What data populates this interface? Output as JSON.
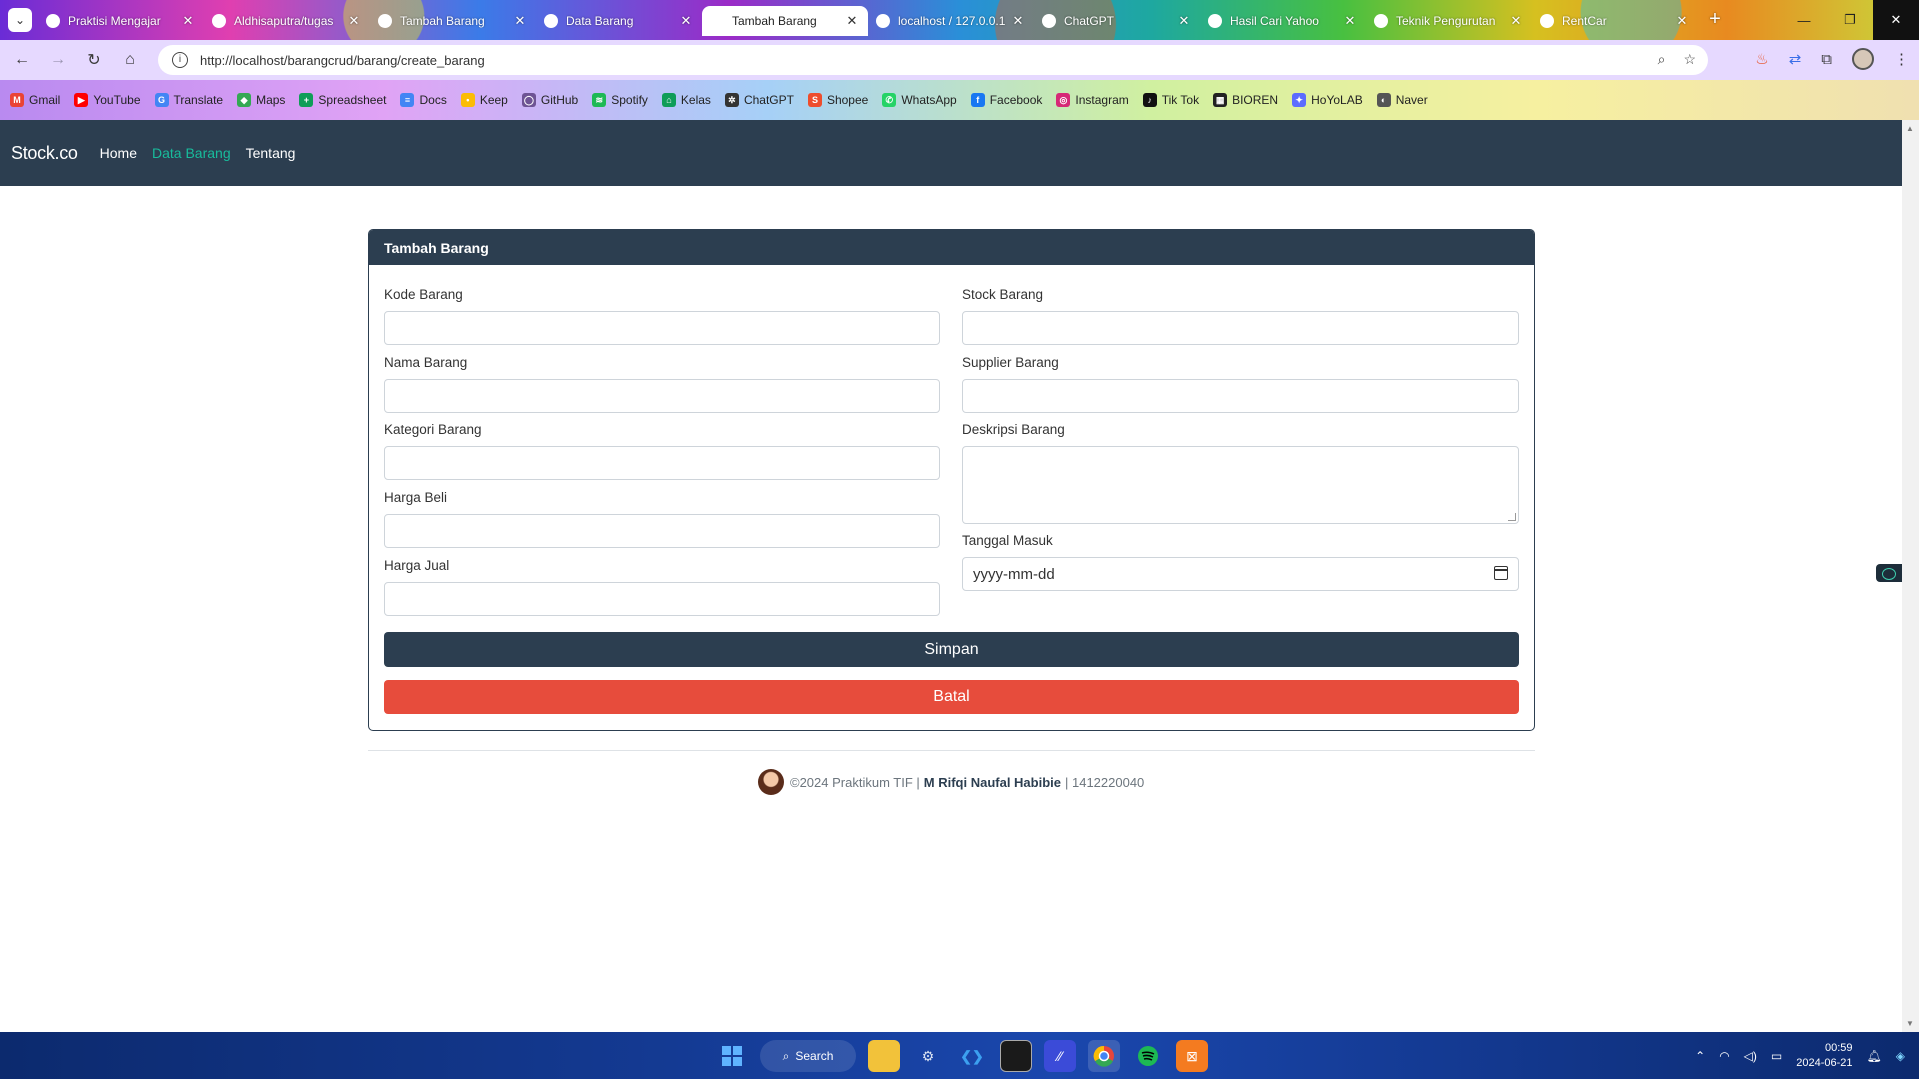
{
  "browser": {
    "tabs": [
      {
        "title": "Praktisi Mengajar",
        "icon": "person-icon",
        "color": "#4a7be8"
      },
      {
        "title": "Aldhisaputra/tugas",
        "icon": "github-icon",
        "color": "#222222"
      },
      {
        "title": "Tambah Barang",
        "icon": "person-photo-icon",
        "color": "#555555"
      },
      {
        "title": "Data Barang",
        "icon": "person-photo-icon",
        "color": "#a0522d"
      },
      {
        "title": "Tambah Barang",
        "icon": "person-photo-icon",
        "color": "#a0522d",
        "active": true
      },
      {
        "title": "localhost / 127.0.0.1",
        "icon": "phpmyadmin-icon",
        "color": "#e88a20"
      },
      {
        "title": "ChatGPT",
        "icon": "chatgpt-icon",
        "color": "#222222"
      },
      {
        "title": "Hasil Cari Yahoo",
        "icon": "yahoo-icon",
        "color": "#6001d2"
      },
      {
        "title": "Teknik Pengurutan",
        "icon": "r-icon",
        "color": "#c0392b"
      },
      {
        "title": "RentCar",
        "icon": "laravel-icon",
        "color": "#ff2d20"
      }
    ],
    "url": "http://localhost/barangcrud/barang/create_barang",
    "bookmarks": [
      {
        "label": "Gmail",
        "color": "#ea4335",
        "glyph": "M"
      },
      {
        "label": "YouTube",
        "color": "#ff0000",
        "glyph": "▶"
      },
      {
        "label": "Translate",
        "color": "#4285f4",
        "glyph": "G"
      },
      {
        "label": "Maps",
        "color": "#34a853",
        "glyph": "◆"
      },
      {
        "label": "Spreadsheet",
        "color": "#0f9d58",
        "glyph": "+"
      },
      {
        "label": "Docs",
        "color": "#4285f4",
        "glyph": "≡"
      },
      {
        "label": "Keep",
        "color": "#fbbc04",
        "glyph": "•"
      },
      {
        "label": "GitHub",
        "color": "#6e5494",
        "glyph": "◯"
      },
      {
        "label": "Spotify",
        "color": "#1db954",
        "glyph": "≋"
      },
      {
        "label": "Kelas",
        "color": "#0f9d58",
        "glyph": "⌂"
      },
      {
        "label": "ChatGPT",
        "color": "#333333",
        "glyph": "✲"
      },
      {
        "label": "Shopee",
        "color": "#ee4d2d",
        "glyph": "S"
      },
      {
        "label": "WhatsApp",
        "color": "#25d366",
        "glyph": "✆"
      },
      {
        "label": "Facebook",
        "color": "#1877f2",
        "glyph": "f"
      },
      {
        "label": "Instagram",
        "color": "#d62976",
        "glyph": "◎"
      },
      {
        "label": "Tik Tok",
        "color": "#111111",
        "glyph": "♪"
      },
      {
        "label": "BIOREN",
        "color": "#222222",
        "glyph": "▦"
      },
      {
        "label": "HoYoLAB",
        "color": "#5b6cff",
        "glyph": "✦"
      },
      {
        "label": "Naver",
        "color": "#555555",
        "glyph": "◐"
      }
    ]
  },
  "site": {
    "brand": "Stock.co",
    "nav": [
      {
        "label": "Home",
        "active": false
      },
      {
        "label": "Data Barang",
        "active": true
      },
      {
        "label": "Tentang",
        "active": false
      }
    ],
    "accent": "#18bc9c",
    "primary": "#2c3e50",
    "danger": "#e74c3c"
  },
  "form": {
    "title": "Tambah Barang",
    "left_fields": [
      {
        "label": "Kode Barang",
        "value": ""
      },
      {
        "label": "Nama Barang",
        "value": ""
      },
      {
        "label": "Kategori Barang",
        "value": ""
      },
      {
        "label": "Harga Beli",
        "value": ""
      },
      {
        "label": "Harga Jual",
        "value": ""
      }
    ],
    "right_fields": [
      {
        "label": "Stock Barang",
        "value": ""
      },
      {
        "label": "Supplier Barang",
        "value": ""
      },
      {
        "label": "Deskripsi Barang",
        "value": "",
        "type": "textarea"
      },
      {
        "label": "Tanggal Masuk",
        "value": "yyyy-mm-dd",
        "type": "date"
      }
    ],
    "submit_label": "Simpan",
    "cancel_label": "Batal"
  },
  "footer": {
    "copyright": "©2024 Praktikum TIF |",
    "author": "M Rifqi Naufal Habibie",
    "nim": "| 1412220040"
  },
  "taskbar": {
    "search_label": "Search",
    "time": "00:59",
    "date": "2024-06-21"
  }
}
